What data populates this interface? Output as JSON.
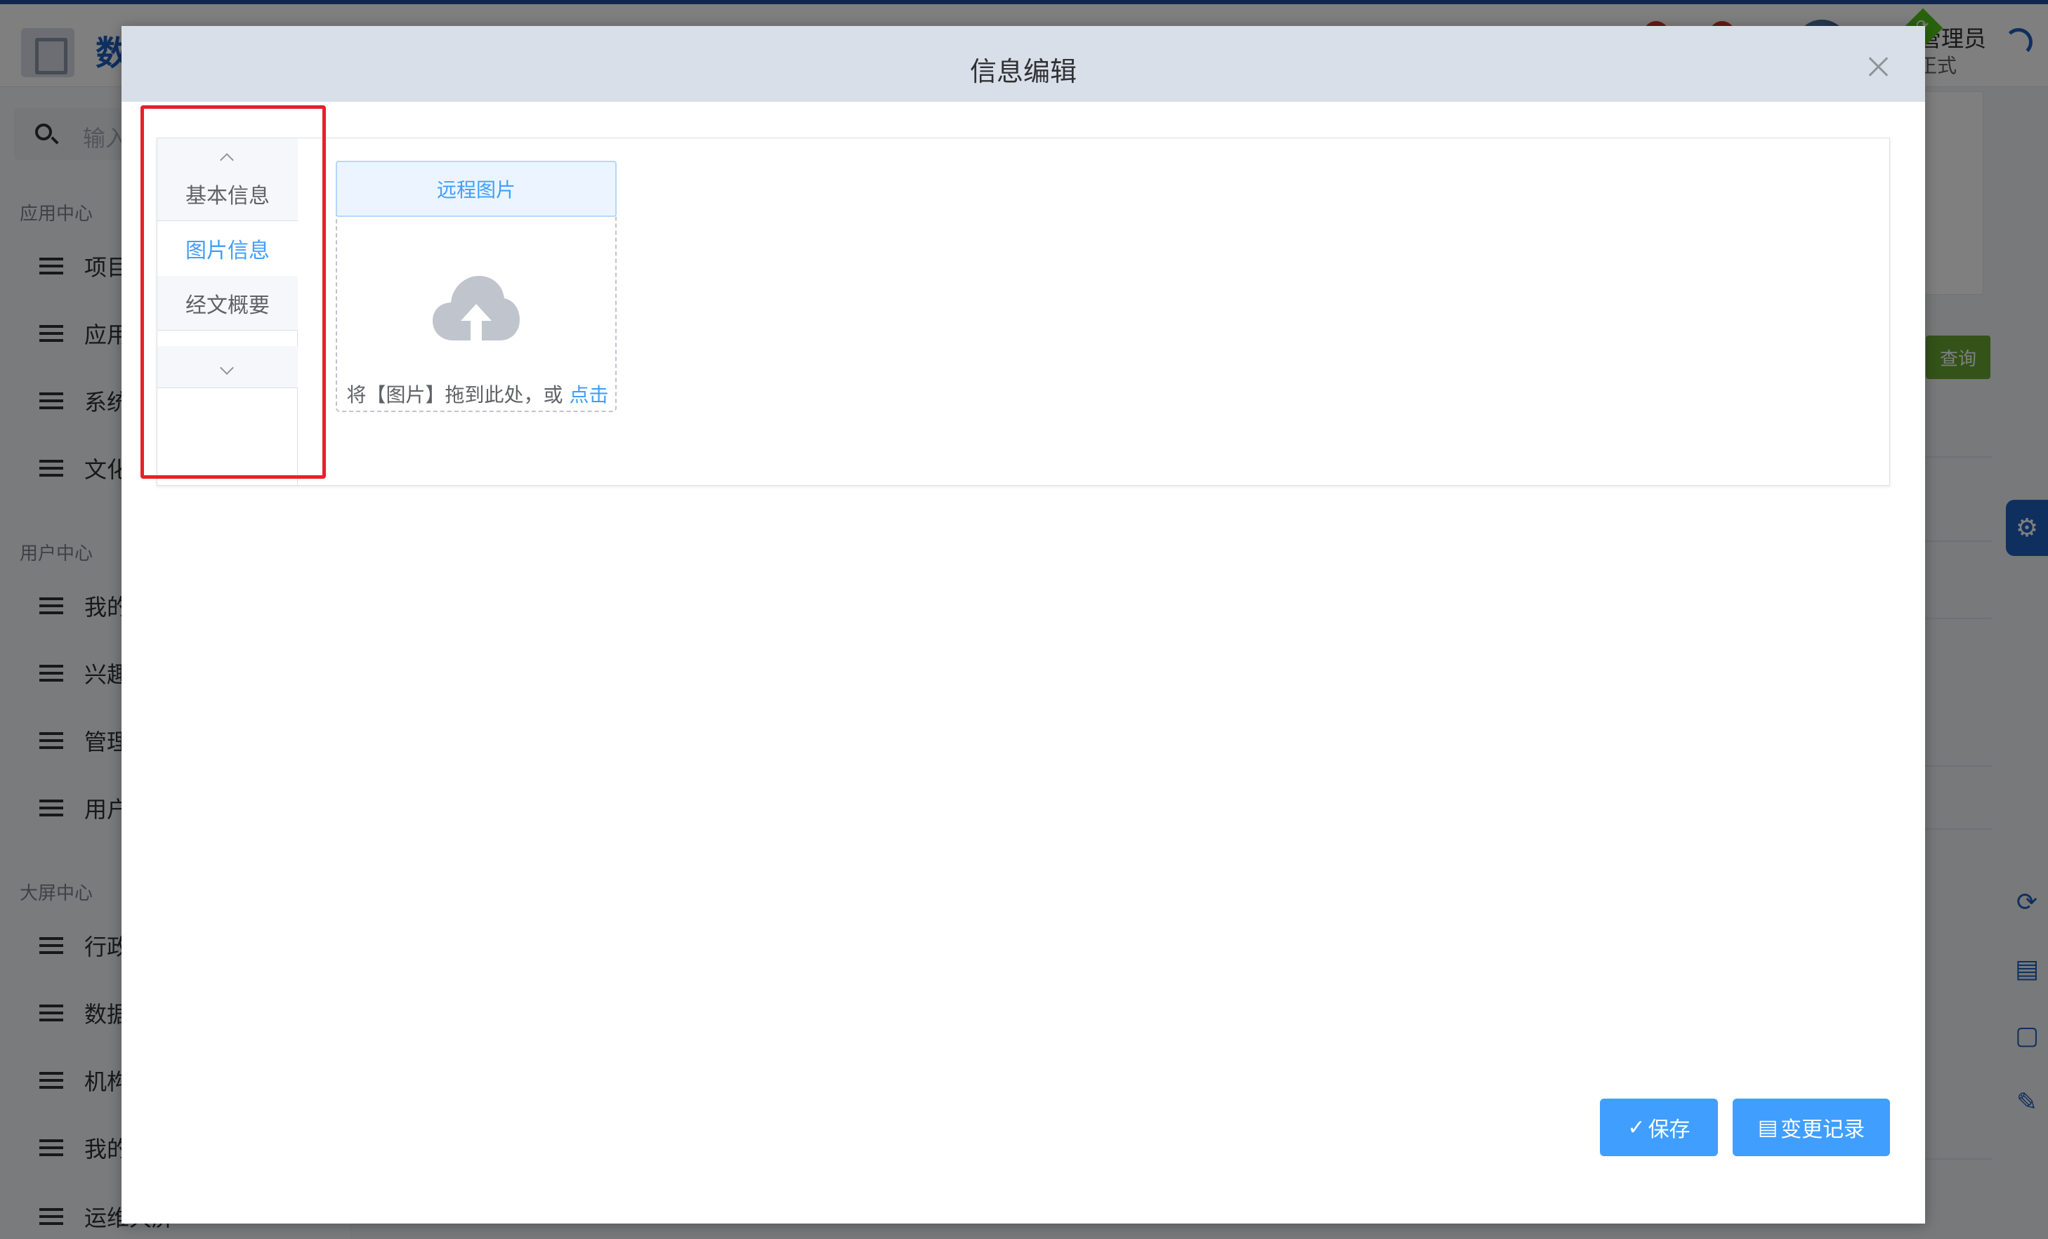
{
  "app": {
    "brand": "数",
    "search_placeholder": "输入标",
    "user_name": "平台管理员",
    "user_sub": "正式",
    "query_button": "查询"
  },
  "sidebar": {
    "groups": [
      {
        "label": "应用中心",
        "items": [
          "项目",
          "应用",
          "系统",
          "文化"
        ]
      },
      {
        "label": "用户中心",
        "items": [
          "我的",
          "兴趣",
          "管理",
          "用户"
        ]
      },
      {
        "label": "大屏中心",
        "items": [
          "行政",
          "数据",
          "机构",
          "我的",
          "运维大屏"
        ]
      }
    ]
  },
  "dialog": {
    "title": "信息编辑",
    "tabs": [
      "基本信息",
      "图片信息",
      "经文概要"
    ],
    "active_tab": "图片信息",
    "upload": {
      "remote_button": "远程图片",
      "drop_text": "将【图片】拖到此处，或",
      "click_text": "点击"
    },
    "buttons": {
      "save": "保存",
      "change_log": "变更记录"
    }
  },
  "colors": {
    "primary": "#409eff",
    "header_bg": "#d9dfe8",
    "highlight": "#e8202a",
    "brand_blue": "#1f5fbf"
  }
}
